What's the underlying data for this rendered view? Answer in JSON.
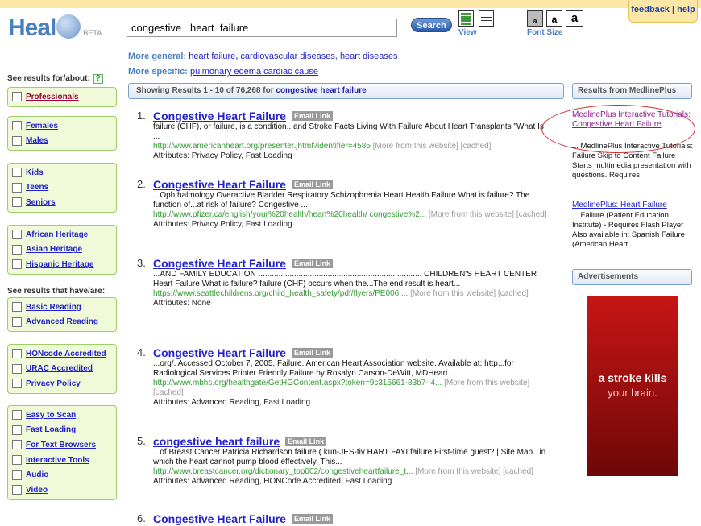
{
  "header": {
    "feedback_label": "feedback",
    "help_label": "help",
    "logo_word": "Heal",
    "logo_beta": "BETA",
    "search_value": "congestive   heart  failure",
    "search_button": "Search",
    "view_label": "View",
    "font_label": "Font Size",
    "font_sizes": [
      "a",
      "a",
      "a"
    ]
  },
  "refine": {
    "general_label": "More general:",
    "general_links": [
      "heart failure",
      "cardiovascular diseases",
      "heart diseases"
    ],
    "specific_label": "More specific:",
    "specific_links": [
      "pulmonary edema cardiac cause"
    ]
  },
  "sidebar": {
    "head_about": "See results for/about:",
    "help_q": "?",
    "head_have": "See results that have/are:",
    "groups": [
      [
        "Professionals"
      ],
      [
        "Females",
        "Males"
      ],
      [
        "Kids",
        "Teens",
        "Seniors"
      ],
      [
        "African Heritage",
        "Asian Heritage",
        "Hispanic Heritage"
      ],
      [
        "Basic Reading",
        "Advanced Reading"
      ],
      [
        "HONcode Accredited",
        "URAC Accredited",
        "Privacy Policy"
      ],
      [
        "Easy to Scan",
        "Fast Loading",
        "For Text Browsers",
        "Interactive Tools",
        "Audio",
        "Video"
      ]
    ]
  },
  "results_bar": {
    "prefix": "Showing Results  1 - 10 of 76,268 for",
    "query": "congestive heart failure"
  },
  "email_label": "Email Link",
  "results": [
    {
      "num": "1.",
      "title": "Congestive Heart Failure",
      "snippet": "failure (CHF), or failure, is a condition...and Stroke Facts Living With Failure About Heart Transplants \"What Is ...",
      "url": "http://www.americanheart.org/presenter.jhtml?identifier=4585",
      "more": "[More from this website]  [cached]",
      "attrs": "Attributes: Privacy Policy, Fast Loading"
    },
    {
      "num": "2.",
      "title": "Congestive Heart Failure",
      "snippet": "...Ophthalmology       Overactive Bladder       Respiratory       Schizophrenia       Heart Health Failure What is failure? The function of...at risk of failure? Congestive ...",
      "url": "http://www.pfizer.ca/english/your%20health/heart%20health/ congestive%2...",
      "more": "[More from this website]  [cached]",
      "attrs": "Attributes: Privacy Policy, Fast Loading"
    },
    {
      "num": "3.",
      "title": "Congestive Heart Failure",
      "snippet": "...AND FAMILY EDUCATION ......................................................................... CHILDREN'S HEART CENTER Heart Failure What is failure? failure (CHF) occurs when the...The end result is heart...",
      "url": "https://www.seattlechildrens.org/child_health_safety/pdf/flyers/PE006....",
      "more": "[More from this website]  [cached]",
      "attrs": "Attributes: None"
    },
    {
      "num": "4.",
      "title": "Congestive Heart Failure",
      "snippet": "...org/. Accessed October 7, 2005. Failure. American Heart Association website. Available at: http...for    Radiological Services       Printer Friendly Failure by Rosalyn Carson-DeWitt, MDHeart...",
      "url": "http://www.mbhs.org/healthgate/GetHGContent.aspx?token=9c315661-83b7- 4...",
      "more": "[More from this website]  [cached]",
      "attrs": "Attributes: Advanced Reading, Fast Loading"
    },
    {
      "num": "5.",
      "title": "congestive heart failure",
      "snippet": "...of Breast Cancer   Patricia Richardson failure ( kun-JES-tiv HART FAYLfailure First-time guest? | Site Map...in which the heart cannot pump blood effectively. This...",
      "url": "http://www.breastcancer.org/dictionary_top002/congestiveheartfailure_t...",
      "more": "[More from this website]  [cached]",
      "attrs": "Attributes: Advanced Reading, HONCode Accredited, Fast Loading"
    },
    {
      "num": "6.",
      "title": "Congestive Heart Failure"
    }
  ],
  "right": {
    "medline_head": "Results from MedlinePlus",
    "item1_title": "MedlinePlus Interactive Tutorials: Congestive Heart Failure",
    "item1_desc": "... MedlinePlus Interactive Tutorials: Failure Skip to Content Failure Starts multimedia presentation with questions. Requires",
    "item2_title": "MedlinePlus: Heart Failure",
    "item2_desc": "... Failure (Patient Education Institute) - Requires Flash Player Also available in: Spanish Failure (American Heart",
    "ads_head": "Advertisements",
    "ad_line1": "a stroke kills",
    "ad_line2": "your brain."
  }
}
